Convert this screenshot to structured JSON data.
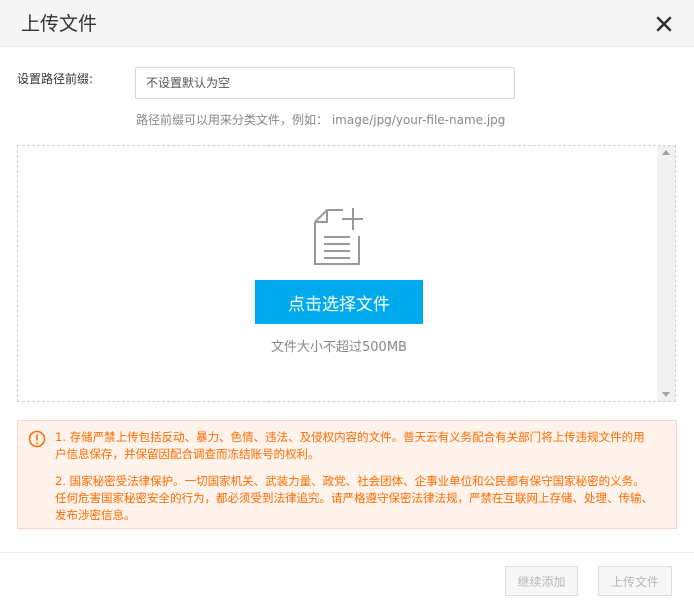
{
  "dialog": {
    "title": "上传文件",
    "close_icon": "close-icon"
  },
  "prefix": {
    "label": "设置路径前缀:",
    "placeholder": "不设置默认为空",
    "value": "",
    "hint": "路径前缀可以用来分类文件，例如： image/jpg/your-file-name.jpg"
  },
  "dropzone": {
    "icon": "file-add-icon",
    "select_button": "点击选择文件",
    "size_limit": "文件大小不超过500MB"
  },
  "notice": {
    "icon": "warning-circle-icon",
    "paragraph1": "1. 存储严禁上传包括反动、暴力、色情、违法、及侵权内容的文件。普天云有义务配合有关部门将上传违规文件的用户信息保存，并保留因配合调查而冻结账号的权利。",
    "paragraph2": "2. 国家秘密受法律保护。一切国家机关、武装力量、政党、社会团体、企事业单位和公民都有保守国家秘密的义务。任何危害国家秘密安全的行为，都必须受到法律追究。请严格遵守保密法律法规，严禁在互联网上存储、处理、传输、发布涉密信息。",
    "color": "#ff6a00"
  },
  "footer": {
    "continue_button": "继续添加",
    "upload_button": "上传文件"
  },
  "colors": {
    "primary": "#00aaee",
    "header_bg": "#f5f5f6"
  }
}
